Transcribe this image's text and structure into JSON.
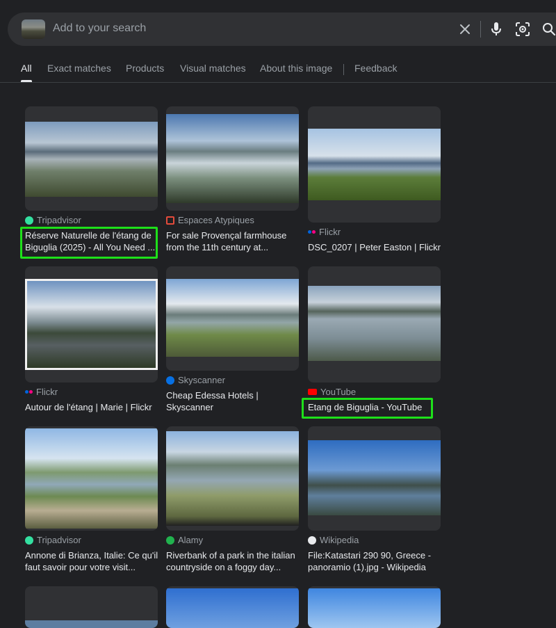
{
  "search": {
    "placeholder": "Add to your search"
  },
  "icons": {
    "clear": "close-icon",
    "voice": "microphone-icon",
    "lens": "lens-camera-icon",
    "search": "search-icon"
  },
  "tabs": [
    {
      "label": "All",
      "active": true
    },
    {
      "label": "Exact matches"
    },
    {
      "label": "Products"
    },
    {
      "label": "Visual matches"
    },
    {
      "label": "About this image"
    },
    {
      "label": "Feedback"
    }
  ],
  "results": [
    {
      "source": "Tripadvisor",
      "title": "Réserve Naturelle de l'étang de Biguglia (2025) - All You Need ...",
      "highlighted": true
    },
    {
      "source": "Espaces Atypiques",
      "title": "For sale Provençal farmhouse from the 11th century at..."
    },
    {
      "source": "Flickr",
      "title": "DSC_0207 | Peter Easton | Flickr"
    },
    {
      "source": "Flickr",
      "title": "Autour de l'étang | Marie | Flickr"
    },
    {
      "source": "Skyscanner",
      "title": "Cheap Edessa Hotels | Skyscanner"
    },
    {
      "source": "YouTube",
      "title": "Etang de Biguglia - YouTube",
      "highlighted": true
    },
    {
      "source": "Tripadvisor",
      "title": "Annone di Brianza, Italie: Ce qu'il faut savoir pour votre visit..."
    },
    {
      "source": "Alamy",
      "title": "Riverbank of a park in the italian countryside on a foggy day..."
    },
    {
      "source": "Wikipedia",
      "title": "File:Katastari 290 90, Greece - panoramio (1).jpg - Wikipedia"
    }
  ],
  "colors": {
    "background": "#202124",
    "highlight": "#1ee01a",
    "tripadvisor": "#34e0a1",
    "youtube": "#ff0000",
    "flickr_blue": "#0063dc",
    "flickr_pink": "#ff0084"
  }
}
